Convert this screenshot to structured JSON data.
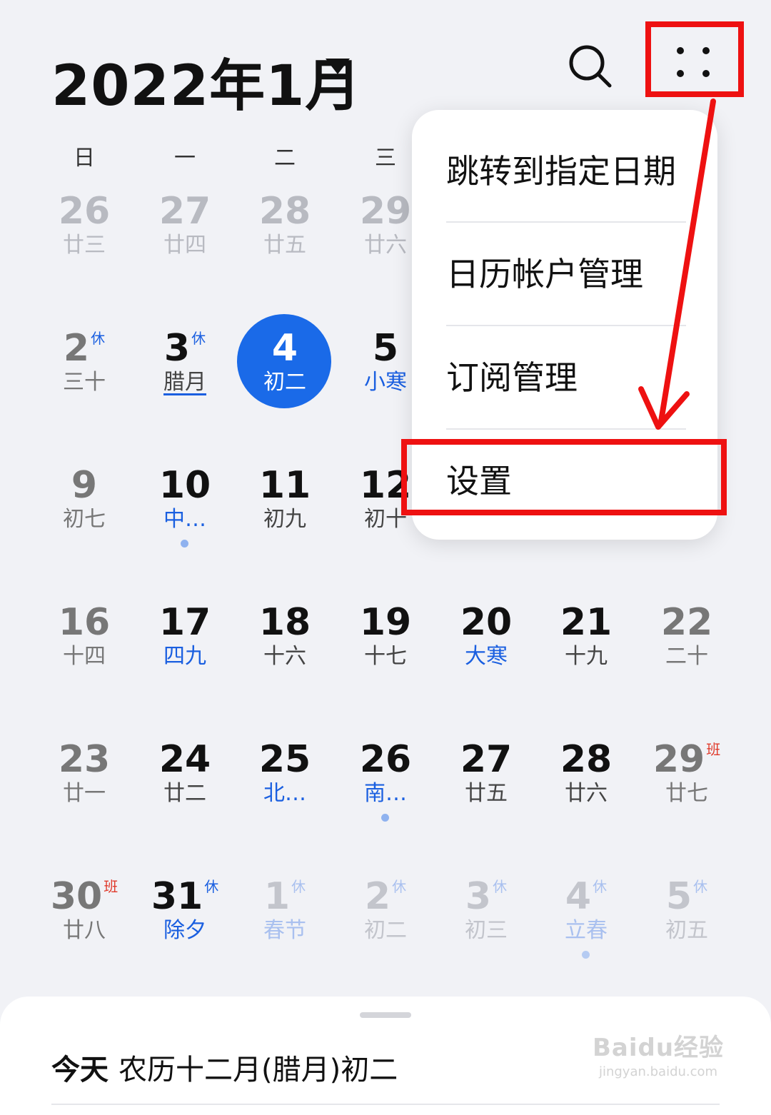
{
  "header": {
    "title": "2022年1月"
  },
  "weekdays": [
    "日",
    "一",
    "二",
    "三"
  ],
  "weeks": [
    {
      "days": [
        {
          "num": "26",
          "sub": "廿三"
        },
        {
          "num": "27",
          "sub": "廿四"
        },
        {
          "num": "28",
          "sub": "廿五"
        },
        {
          "num": "29",
          "sub": "廿六"
        }
      ]
    },
    {
      "days": [
        {
          "num": "2",
          "sub": "三十",
          "badge": "休"
        },
        {
          "num": "3",
          "sub": "腊月",
          "badge": "休"
        },
        {
          "num": "4",
          "sub": "初二"
        },
        {
          "num": "5",
          "sub": "小寒"
        }
      ]
    },
    {
      "days": [
        {
          "num": "9",
          "sub": "初七"
        },
        {
          "num": "10",
          "sub": "中…"
        },
        {
          "num": "11",
          "sub": "初九"
        },
        {
          "num": "12",
          "sub": "初十"
        }
      ]
    },
    {
      "days": [
        {
          "num": "16",
          "sub": "十四"
        },
        {
          "num": "17",
          "sub": "四九"
        },
        {
          "num": "18",
          "sub": "十六"
        },
        {
          "num": "19",
          "sub": "十七"
        },
        {
          "num": "20",
          "sub": "大寒"
        },
        {
          "num": "21",
          "sub": "十九"
        },
        {
          "num": "22",
          "sub": "二十"
        }
      ]
    },
    {
      "days": [
        {
          "num": "23",
          "sub": "廿一"
        },
        {
          "num": "24",
          "sub": "廿二"
        },
        {
          "num": "25",
          "sub": "北…"
        },
        {
          "num": "26",
          "sub": "南…"
        },
        {
          "num": "27",
          "sub": "廿五"
        },
        {
          "num": "28",
          "sub": "廿六"
        },
        {
          "num": "29",
          "sub": "廿七",
          "badge": "班"
        }
      ]
    },
    {
      "days": [
        {
          "num": "30",
          "sub": "廿八",
          "badge": "班"
        },
        {
          "num": "31",
          "sub": "除夕",
          "badge": "休"
        },
        {
          "num": "1",
          "sub": "春节",
          "badge": "休"
        },
        {
          "num": "2",
          "sub": "初二",
          "badge": "休"
        },
        {
          "num": "3",
          "sub": "初三",
          "badge": "休"
        },
        {
          "num": "4",
          "sub": "立春",
          "badge": "休"
        },
        {
          "num": "5",
          "sub": "初五",
          "badge": "休"
        }
      ]
    }
  ],
  "menu": {
    "items": [
      "跳转到指定日期",
      "日历帐户管理",
      "订阅管理",
      "设置"
    ]
  },
  "today_panel": {
    "label": "今天",
    "lunar": "农历十二月(腊月)初二"
  },
  "watermark": {
    "main": "Baidu经验",
    "sub": "jingyan.baidu.com"
  },
  "colors": {
    "accent": "#1a6ae8",
    "highlight": "#ee1111"
  },
  "icons": [
    "search-icon",
    "more-icon",
    "dropdown-caret-icon"
  ]
}
